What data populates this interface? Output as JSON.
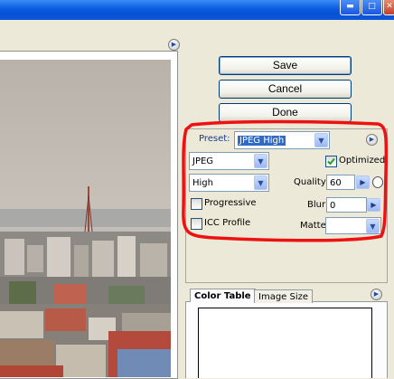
{
  "window": {
    "controls": [
      "minimize",
      "maximize",
      "close"
    ]
  },
  "buttons": {
    "save": "Save",
    "cancel": "Cancel",
    "done": "Done"
  },
  "settings": {
    "preset_label": "Preset:",
    "preset_value": "JPEG High",
    "format_value": "JPEG",
    "quality_level_value": "High",
    "optimized_label": "Optimized",
    "optimized_checked": true,
    "quality_label": "Quality:",
    "quality_value": "60",
    "progressive_label": "Progressive",
    "progressive_checked": false,
    "blur_label": "Blur:",
    "blur_value": "0",
    "icc_profile_label": "ICC Profile",
    "icc_profile_checked": false,
    "matte_label": "Matte:",
    "matte_value": ""
  },
  "tabs": [
    {
      "label": "Color Table",
      "active": true
    },
    {
      "label": "Image Size",
      "active": false
    }
  ],
  "colors": {
    "highlight_loop": "#ee1111",
    "titlebar": "#0a5ce0",
    "button_border": "#003c74"
  },
  "icons": [
    "menu-arrow-icon",
    "dropdown-arrow-icon",
    "slider-arrow-icon",
    "checkmark-icon",
    "eyedropper-icon"
  ]
}
